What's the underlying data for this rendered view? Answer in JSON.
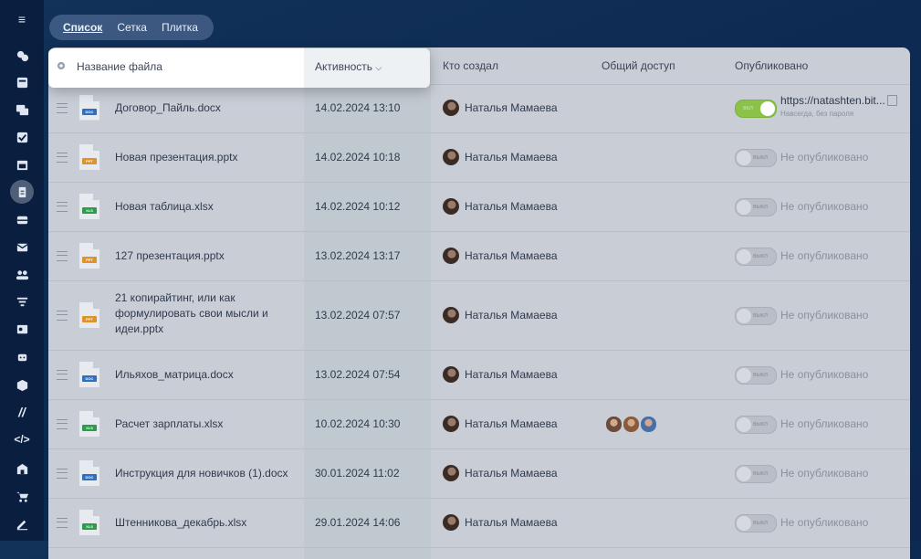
{
  "view_tabs": [
    "Список",
    "Сетка",
    "Плитка"
  ],
  "columns": {
    "name": "Название файла",
    "activity": "Активность",
    "author": "Кто создал",
    "sharing": "Общий доступ",
    "published": "Опубликовано"
  },
  "toggle_labels": {
    "on": "вкл",
    "off": "выкл"
  },
  "rows": [
    {
      "icon": "doc",
      "name": "Договор_Пайль.docx",
      "date": "14.02.2024 13:10",
      "author": "Наталья Мамаева",
      "published": true,
      "link": "https://natashten.bit...",
      "link_note": "Навсегда, без пароля"
    },
    {
      "icon": "ppt",
      "name": "Новая презентация.pptx",
      "date": "14.02.2024 10:18",
      "author": "Наталья Мамаева",
      "published": false,
      "status": "Не опубликовано"
    },
    {
      "icon": "xls",
      "name": "Новая таблица.xlsx",
      "date": "14.02.2024 10:12",
      "author": "Наталья Мамаева",
      "published": false,
      "status": "Не опубликовано"
    },
    {
      "icon": "ppt",
      "name": "127 презентация.pptx",
      "date": "13.02.2024 13:17",
      "author": "Наталья Мамаева",
      "published": false,
      "status": "Не опубликовано"
    },
    {
      "icon": "ppt",
      "name_lines": [
        "21 копирайтинг, или как",
        "формулировать свои мысли и",
        "идеи.pptx"
      ],
      "date": "13.02.2024 07:57",
      "author": "Наталья Мамаева",
      "published": false,
      "status": "Не опубликовано"
    },
    {
      "icon": "doc",
      "name": "Ильяхов_матрица.docx",
      "date": "13.02.2024 07:54",
      "author": "Наталья Мамаева",
      "published": false,
      "status": "Не опубликовано"
    },
    {
      "icon": "xls",
      "name": "Расчет зарплаты.xlsx",
      "date": "10.02.2024 10:30",
      "author": "Наталья Мамаева",
      "shared_avatars": 3,
      "published": false,
      "status": "Не опубликовано"
    },
    {
      "icon": "doc",
      "name": "Инструкция для новичков (1).docx",
      "date": "30.01.2024 11:02",
      "author": "Наталья Мамаева",
      "published": false,
      "status": "Не опубликовано"
    },
    {
      "icon": "xls",
      "name": "Штенникова_декабрь.xlsx",
      "date": "29.01.2024 14:06",
      "author": "Наталья Мамаева",
      "published": false,
      "status": "Не опубликовано"
    }
  ],
  "file_badges": {
    "doc": "DOC",
    "ppt": "PPT",
    "xls": "XLS"
  },
  "badge_colors": {
    "doc": "#2f6fbf",
    "ppt": "#e0922a",
    "xls": "#2e9b4a"
  },
  "rail_icons": [
    "menu-icon",
    "chat-bubbles-icon",
    "tasks-icon",
    "messages-icon",
    "checkbox-icon",
    "calendar-icon",
    "documents-icon",
    "storage-icon",
    "mail-icon",
    "team-icon",
    "filter-icon",
    "contact-card-icon",
    "robot-icon",
    "box-icon",
    "marketing-icon",
    "code-icon",
    "office-building-icon",
    "cart-icon",
    "sign-icon"
  ]
}
